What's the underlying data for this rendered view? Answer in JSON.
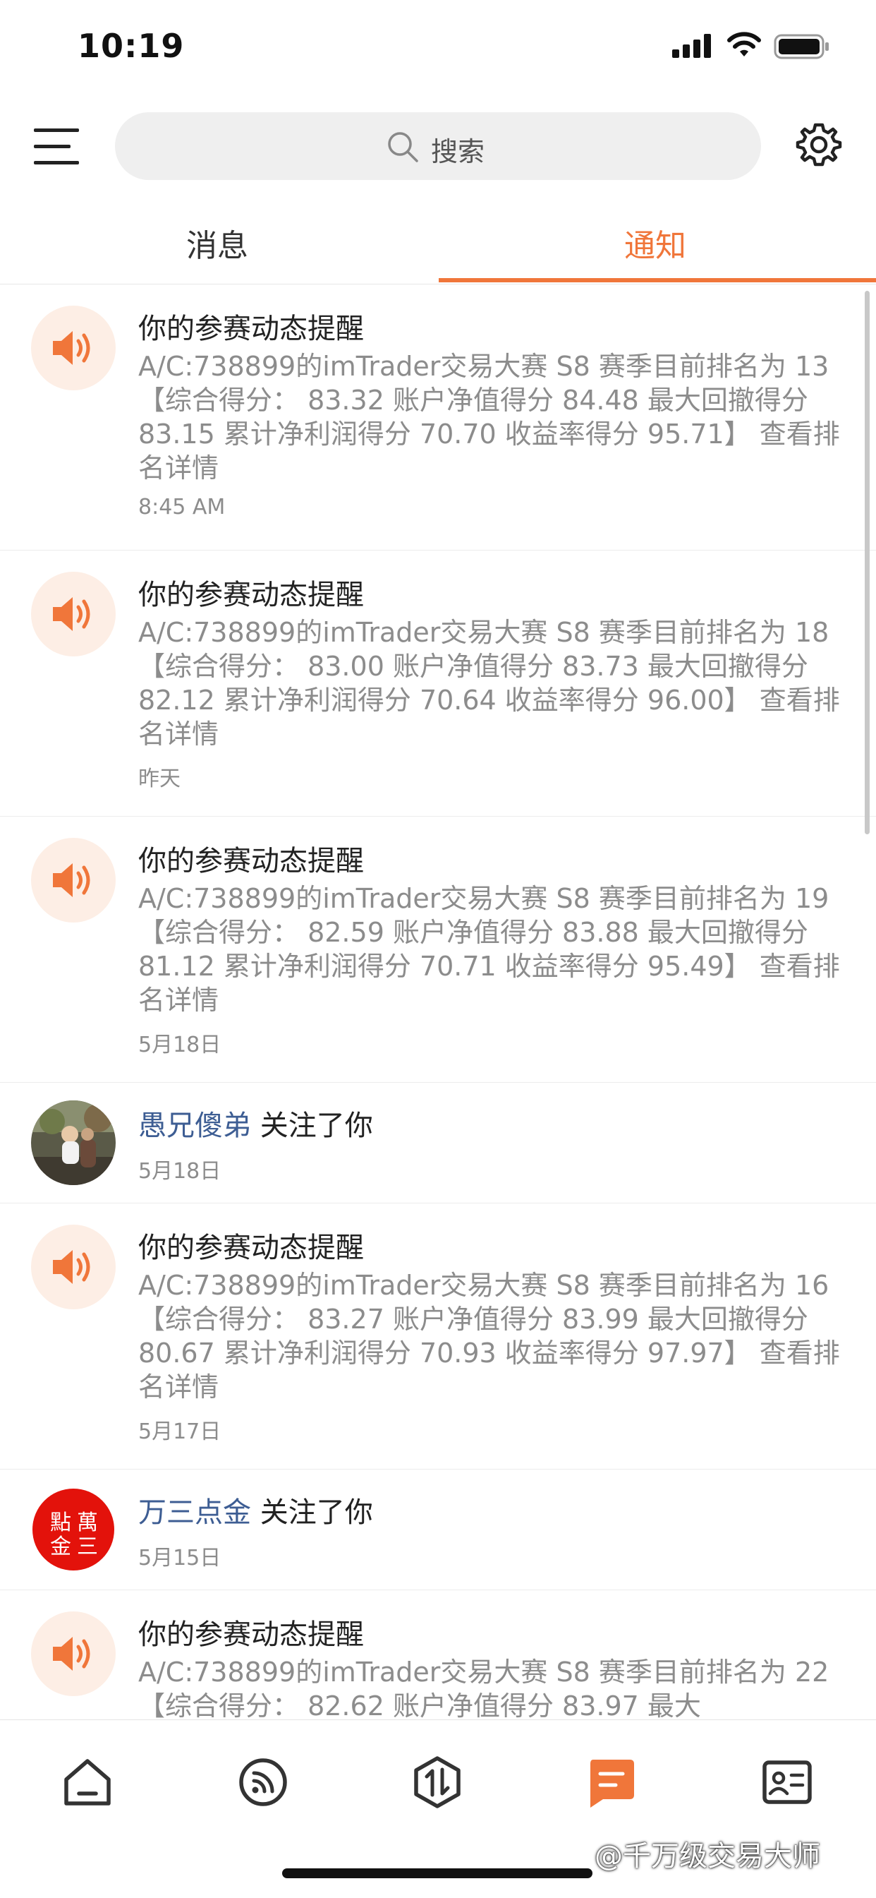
{
  "status_bar": {
    "time": "10:19"
  },
  "header": {
    "search_placeholder": "搜索"
  },
  "tabs": [
    {
      "label": "消息"
    },
    {
      "label": "通知"
    }
  ],
  "notifications": [
    {
      "title": "你的参赛动态提醒",
      "body": "A/C:738899的imTrader交易大赛 S8 赛季目前排名为 13 【综合得分： 83.32 账户净值得分 84.48 最大回撤得分 83.15 累计净利润得分 70.70 收益率得分 95.71】",
      "link": "查看排名详情",
      "time": "8:45 AM"
    },
    {
      "title": "你的参赛动态提醒",
      "body": "A/C:738899的imTrader交易大赛 S8 赛季目前排名为 18 【综合得分： 83.00 账户净值得分 83.73 最大回撤得分 82.12 累计净利润得分 70.64 收益率得分 96.00】",
      "link": "查看排名详情",
      "time": "昨天"
    },
    {
      "title": "你的参赛动态提醒",
      "body": "A/C:738899的imTrader交易大赛 S8 赛季目前排名为 19 【综合得分： 82.59 账户净值得分 83.88 最大回撤得分 81.12 累计净利润得分 70.71 收益率得分 95.49】",
      "link": "查看排名详情",
      "time": "5月18日"
    },
    {
      "user": "愚兄傻弟",
      "action": "关注了你",
      "time": "5月18日"
    },
    {
      "title": "你的参赛动态提醒",
      "body": "A/C:738899的imTrader交易大赛 S8 赛季目前排名为 16 【综合得分： 83.27 账户净值得分 83.99 最大回撤得分 80.67 累计净利润得分 70.93 收益率得分 97.97】",
      "link": "查看排名详情",
      "time": "5月17日"
    },
    {
      "user": "万三点金",
      "action": "关注了你",
      "time": "5月15日",
      "avatar_seal": "點金萬三"
    },
    {
      "title": "你的参赛动态提醒",
      "body": "A/C:738899的imTrader交易大赛 S8 赛季目前排名为 22 【综合得分： 82.62 账户净值得分 83.97 最大",
      "link": "",
      "time": ""
    }
  ],
  "bottom_nav": [
    {
      "icon": "home-icon",
      "active": false
    },
    {
      "icon": "feed-icon",
      "active": false
    },
    {
      "icon": "trade-icon",
      "active": false
    },
    {
      "icon": "message-icon",
      "active": true
    },
    {
      "icon": "profile-card-icon",
      "active": false
    }
  ],
  "watermark": "@千万级交易大师",
  "colors": {
    "accent": "#f0763a",
    "username": "#3d5d93",
    "secondary_text": "#8c8c8c"
  }
}
